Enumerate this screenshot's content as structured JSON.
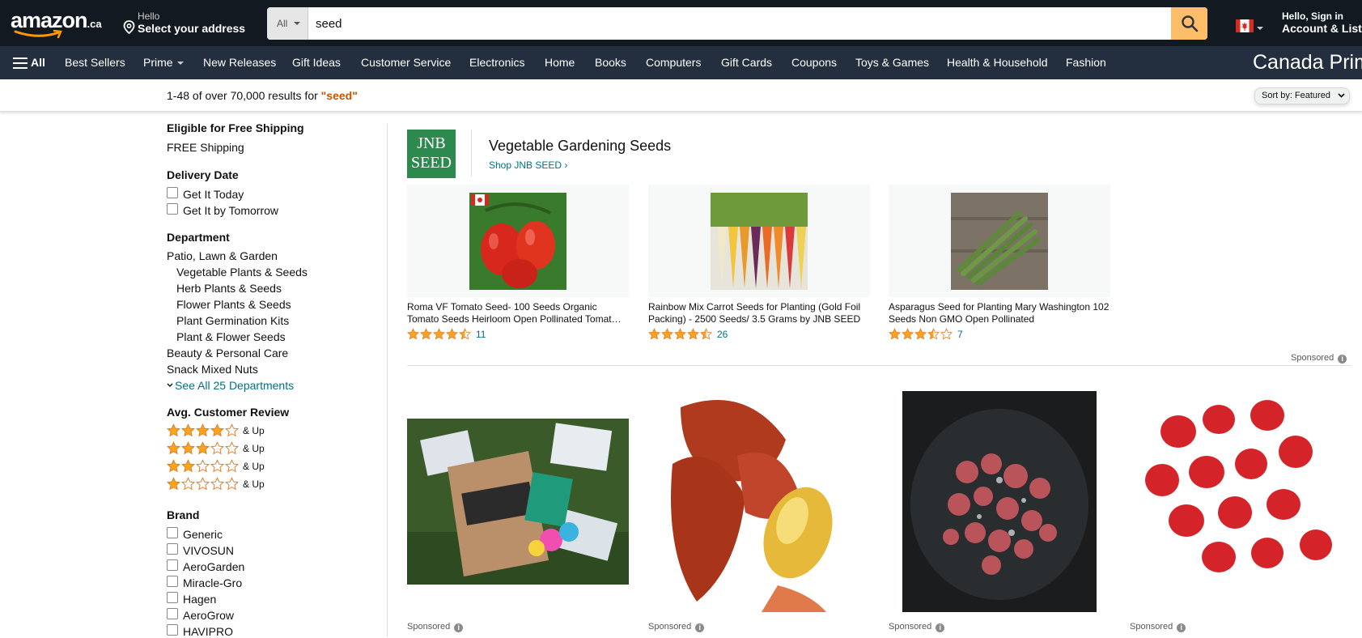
{
  "header": {
    "logo_text": "amazon",
    "logo_tld": ".ca",
    "address_hello": "Hello",
    "address_select": "Select your address",
    "search_category": "All",
    "search_value": "seed",
    "account_hello": "Hello, Sign in",
    "account_lists": "Account & Lists"
  },
  "nav": {
    "all_label": "All",
    "items": [
      "Best Sellers",
      "Prime",
      "New Releases",
      "Gift Ideas",
      "Customer Service",
      "Electronics",
      "Home",
      "Books",
      "Computers",
      "Gift Cards",
      "Coupons",
      "Toys & Games",
      "Health & Household",
      "Fashion"
    ],
    "promo": "Canada Prim"
  },
  "results": {
    "count_text": "1-48 of over 70,000 results for ",
    "query": "\"seed\"",
    "sort_label": "Sort by:",
    "sort_value": "Featured"
  },
  "sidebar": {
    "free_shipping_heading": "Eligible for Free Shipping",
    "free_shipping_option": "FREE Shipping",
    "delivery_heading": "Delivery Date",
    "delivery_options": [
      "Get It Today",
      "Get It by Tomorrow"
    ],
    "department_heading": "Department",
    "department_top": "Patio, Lawn & Garden",
    "department_sub": [
      "Vegetable Plants & Seeds",
      "Herb Plants & Seeds",
      "Flower Plants & Seeds",
      "Plant Germination Kits",
      "Plant & Flower Seeds"
    ],
    "department_other": [
      "Beauty & Personal Care",
      "Snack Mixed Nuts"
    ],
    "see_all": "See All 25 Departments",
    "review_heading": "Avg. Customer Review",
    "review_rows": [
      {
        "stars": 4,
        "label": "& Up"
      },
      {
        "stars": 3,
        "label": "& Up"
      },
      {
        "stars": 2,
        "label": "& Up"
      },
      {
        "stars": 1,
        "label": "& Up"
      }
    ],
    "brand_heading": "Brand",
    "brands": [
      "Generic",
      "VIVOSUN",
      "AeroGarden",
      "Miracle-Gro",
      "Hagen",
      "AeroGrow",
      "HAVIPRO"
    ]
  },
  "sponsored_brand": {
    "logo_line1": "JNB",
    "logo_line2": "SEED",
    "title": "Vegetable Gardening Seeds",
    "shop_link": "Shop JNB SEED ›",
    "sponsored_label": "Sponsored",
    "products": [
      {
        "title": "Roma VF Tomato Seed- 100 Seeds Organic Tomato Seeds Heirloom Open Pollinated Tomat…",
        "rating": 4.5,
        "count": "11"
      },
      {
        "title": "Rainbow Mix Carrot Seeds for Planting (Gold Foil Packing) - 2500 Seeds/ 3.5 Grams by JNB SEED",
        "rating": 4.5,
        "count": "26"
      },
      {
        "title": "Asparagus Seed for Planting Mary Washington 102 Seeds Non GMO Open Pollinated",
        "rating": 3.5,
        "count": "7"
      }
    ]
  },
  "grid": {
    "sponsored_label": "Sponsored"
  },
  "colors": {
    "header_bg": "#131921",
    "nav_bg": "#232f3e",
    "search_button": "#febd69",
    "star": "#ffa41c",
    "link": "#007185",
    "query": "#c45500"
  }
}
